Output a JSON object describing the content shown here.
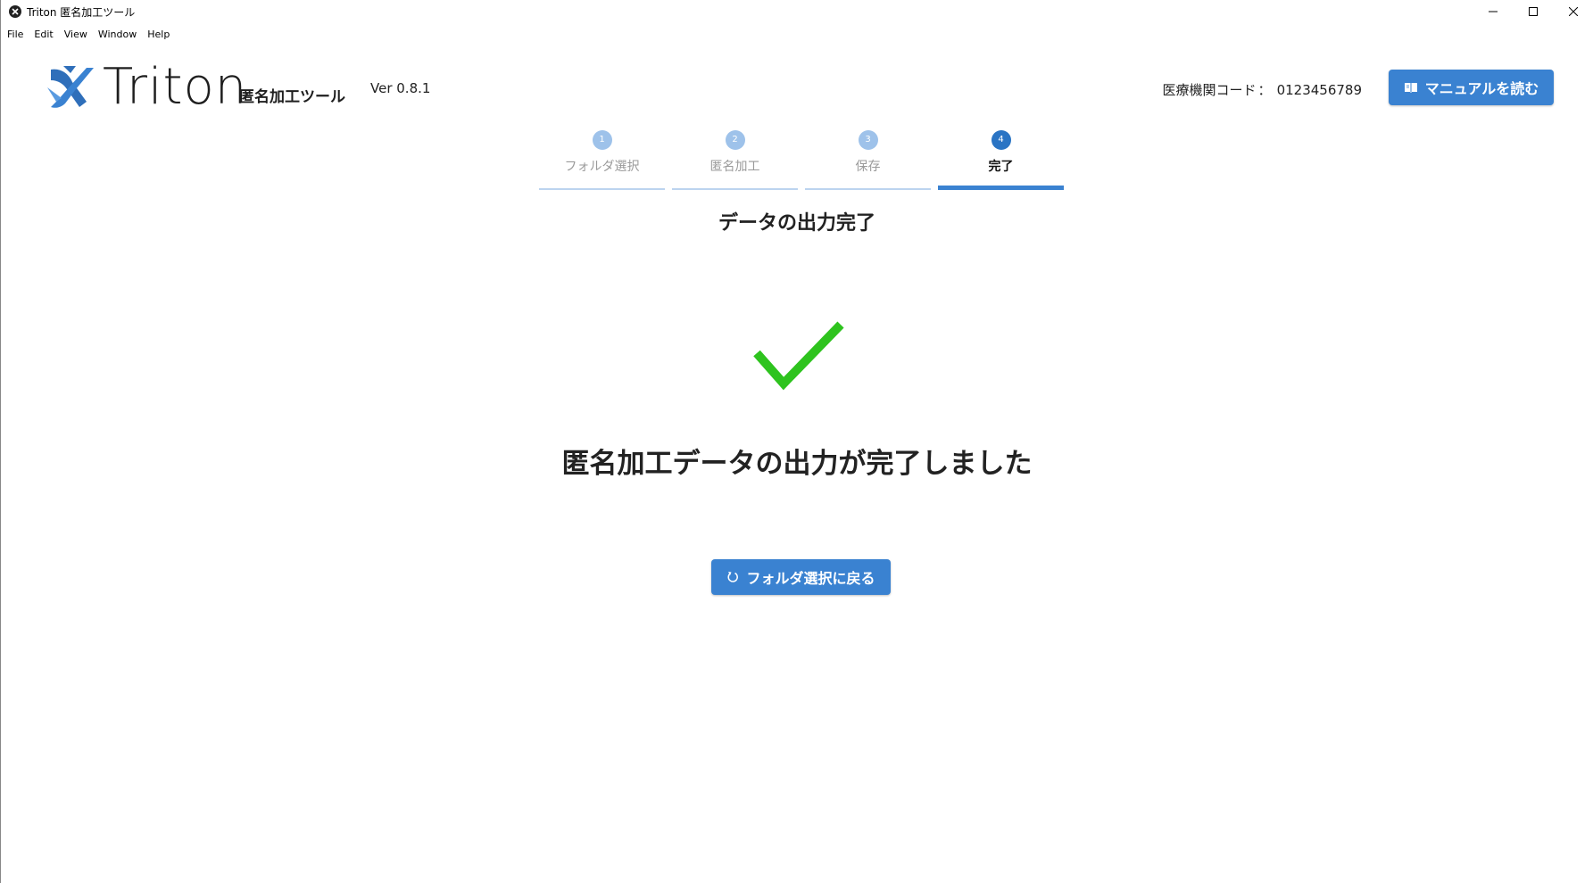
{
  "window": {
    "title": "Triton 匿名加工ツール"
  },
  "menu": [
    "File",
    "Edit",
    "View",
    "Window",
    "Help"
  ],
  "header": {
    "logo_text": "Triton",
    "logo_subtitle": "匿名加工ツール",
    "version": "Ver 0.8.1",
    "institution_label": "医療機関コード",
    "institution_separator": "：",
    "institution_code": "0123456789",
    "manual_button": "マニュアルを読む"
  },
  "steps": [
    {
      "num": "1",
      "label": "フォルダ選択",
      "active": false
    },
    {
      "num": "2",
      "label": "匿名加工",
      "active": false
    },
    {
      "num": "3",
      "label": "保存",
      "active": false
    },
    {
      "num": "4",
      "label": "完了",
      "active": true
    }
  ],
  "main": {
    "section_title": "データの出力完了",
    "completion_message": "匿名加工データの出力が完了しました",
    "back_button": "フォルダ選択に戻る"
  },
  "colors": {
    "accent": "#3a82d1",
    "check": "#2ec31e",
    "step_inactive": "#9ec2ea"
  }
}
